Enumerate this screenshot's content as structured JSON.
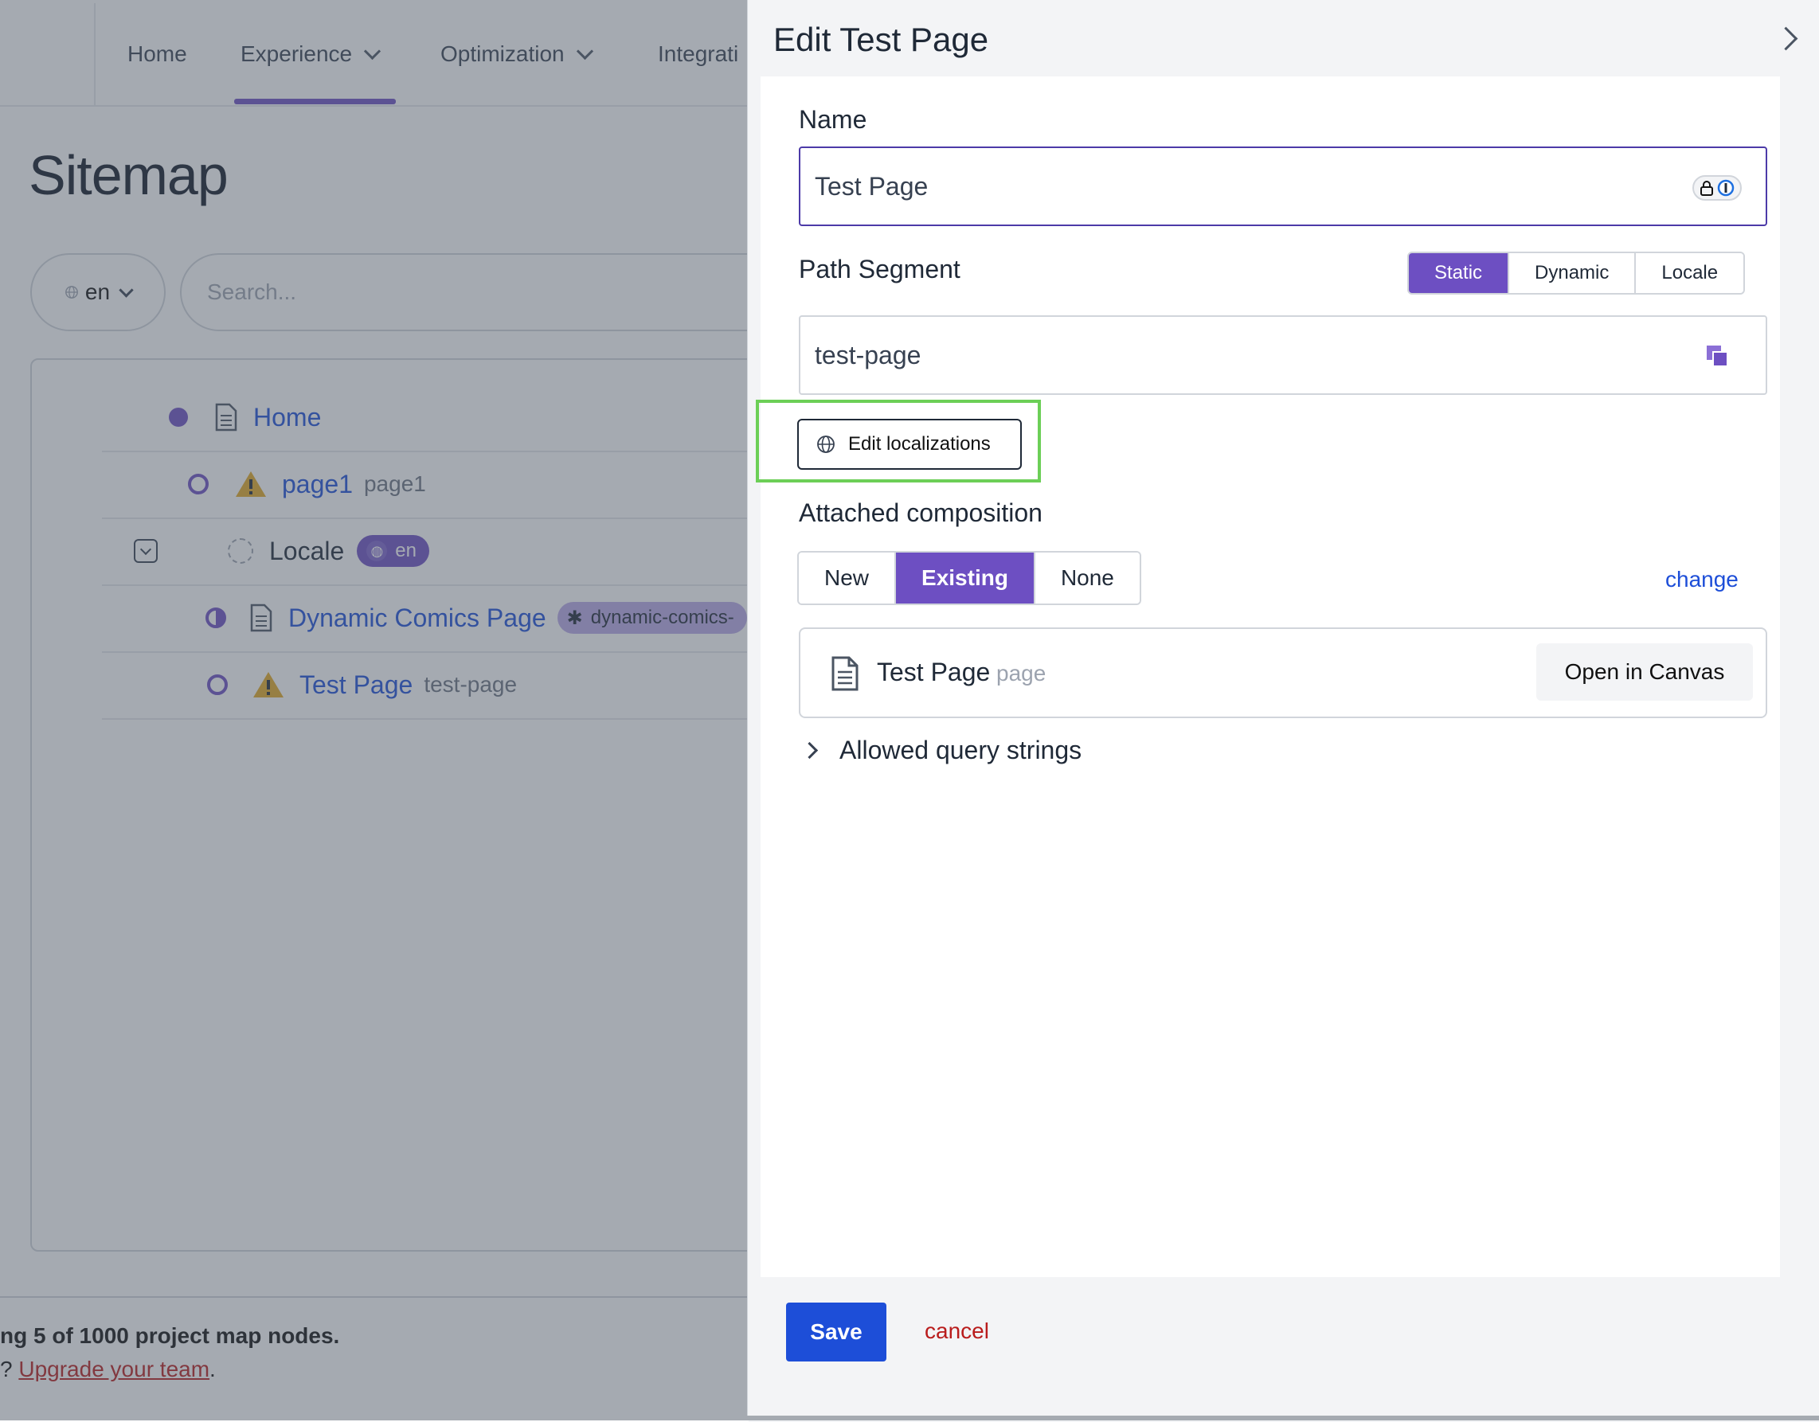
{
  "nav": {
    "items": [
      {
        "label": "Home",
        "has_dropdown": false
      },
      {
        "label": "Experience",
        "has_dropdown": true
      },
      {
        "label": "Optimization",
        "has_dropdown": true
      },
      {
        "label": "Integrati",
        "has_dropdown": false
      }
    ]
  },
  "sitemap": {
    "title": "Sitemap",
    "locale_value": "en",
    "search_placeholder": "Search...",
    "tree": [
      {
        "label": "Home",
        "sub": "",
        "status": "published"
      },
      {
        "label": "page1",
        "sub": "page1",
        "status": "draft",
        "warning": true
      },
      {
        "label": "Locale",
        "sub": "",
        "status": "placeholder",
        "badge": "en",
        "collapsible": true
      },
      {
        "label": "Dynamic Comics Page",
        "sub": "",
        "status": "modified",
        "badge": "dynamic-comics-"
      },
      {
        "label": "Test Page",
        "sub": "test-page",
        "status": "draft",
        "warning": true
      }
    ],
    "footer_text": "ng 5 of 1000 project map nodes.",
    "footer_prefix": "? ",
    "footer_link": "Upgrade your team",
    "footer_suffix": "."
  },
  "drawer": {
    "title": "Edit Test Page",
    "name_label": "Name",
    "name_value": "Test Page",
    "path_label": "Path Segment",
    "path_options": [
      "Static",
      "Dynamic",
      "Locale"
    ],
    "path_selected": "Static",
    "path_value": "test-page",
    "edit_localizations": "Edit localizations",
    "composition_label": "Attached composition",
    "composition_options": [
      "New",
      "Existing",
      "None"
    ],
    "composition_selected": "Existing",
    "change_link": "change",
    "composition_name": "Test Page",
    "composition_type": "page",
    "open_canvas": "Open in Canvas",
    "allowed_query_strings": "Allowed query strings",
    "save": "Save",
    "cancel": "cancel"
  },
  "colors": {
    "accent": "#6d4fc2",
    "link": "#1d4ed8",
    "highlight": "#6ccf57",
    "danger": "#b91c1c"
  }
}
